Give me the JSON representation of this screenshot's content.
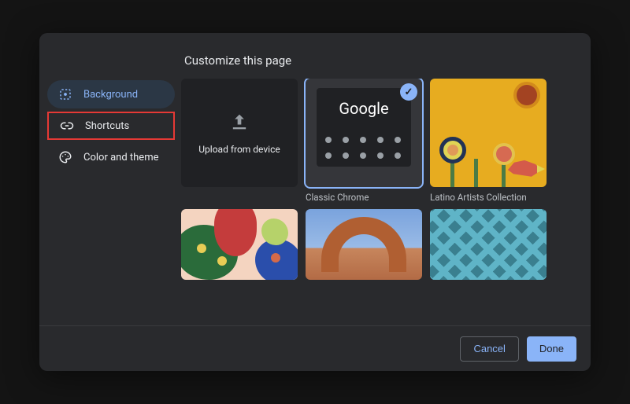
{
  "title": "Customize this page",
  "sidebar": {
    "items": [
      {
        "label": "Background",
        "icon": "image-frame",
        "state": "active"
      },
      {
        "label": "Shortcuts",
        "icon": "link",
        "state": "highlighted"
      },
      {
        "label": "Color and theme",
        "icon": "palette",
        "state": "normal"
      }
    ]
  },
  "backgrounds": {
    "upload_label": "Upload from device",
    "tiles": [
      {
        "type": "upload",
        "caption": ""
      },
      {
        "type": "classic-chrome",
        "caption": "Classic Chrome",
        "selected": true,
        "logo_text": "Google"
      },
      {
        "type": "collection",
        "caption": "Latino Artists Collection",
        "thumb": "latino"
      },
      {
        "type": "collection",
        "caption": "",
        "thumb": "blobs"
      },
      {
        "type": "collection",
        "caption": "",
        "thumb": "arch"
      },
      {
        "type": "collection",
        "caption": "",
        "thumb": "geometric"
      }
    ]
  },
  "footer": {
    "cancel": "Cancel",
    "done": "Done"
  },
  "colors": {
    "accent": "#8ab4f8",
    "highlight_border": "#e53935"
  }
}
